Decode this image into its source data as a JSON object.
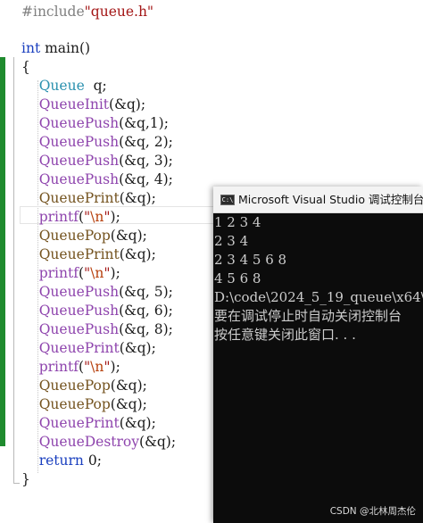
{
  "editor": {
    "lines": [
      [
        {
          "t": "#include",
          "c": "pre"
        },
        {
          "t": "\"queue.h\"",
          "c": "str"
        }
      ],
      [],
      [
        {
          "t": "int",
          "c": "kw"
        },
        {
          "t": " main()",
          "c": ""
        }
      ],
      [
        {
          "t": "{",
          "c": ""
        }
      ],
      [
        {
          "t": "    ",
          "c": ""
        },
        {
          "t": "Queue",
          "c": "type"
        },
        {
          "t": "  q;",
          "c": ""
        }
      ],
      [
        {
          "t": "    ",
          "c": ""
        },
        {
          "t": "QueueInit",
          "c": "macro"
        },
        {
          "t": "(&q);",
          "c": ""
        }
      ],
      [
        {
          "t": "    ",
          "c": ""
        },
        {
          "t": "QueuePush",
          "c": "macro"
        },
        {
          "t": "(&q,1);",
          "c": ""
        }
      ],
      [
        {
          "t": "    ",
          "c": ""
        },
        {
          "t": "QueuePush",
          "c": "macro"
        },
        {
          "t": "(&q, 2);",
          "c": ""
        }
      ],
      [
        {
          "t": "    ",
          "c": ""
        },
        {
          "t": "QueuePush",
          "c": "macro"
        },
        {
          "t": "(&q, 3);",
          "c": ""
        }
      ],
      [
        {
          "t": "    ",
          "c": ""
        },
        {
          "t": "QueuePush",
          "c": "macro"
        },
        {
          "t": "(&q, 4);",
          "c": ""
        }
      ],
      [
        {
          "t": "    ",
          "c": ""
        },
        {
          "t": "QueuePrint",
          "c": "fn"
        },
        {
          "t": "(&q);",
          "c": ""
        }
      ],
      [
        {
          "t": "    ",
          "c": ""
        },
        {
          "t": "printf",
          "c": "macro"
        },
        {
          "t": "(",
          "c": ""
        },
        {
          "t": "\"",
          "c": "str"
        },
        {
          "t": "\\n",
          "c": "esc"
        },
        {
          "t": "\"",
          "c": "str"
        },
        {
          "t": ");",
          "c": ""
        }
      ],
      [
        {
          "t": "    ",
          "c": ""
        },
        {
          "t": "QueuePop",
          "c": "fn"
        },
        {
          "t": "(&q);",
          "c": ""
        }
      ],
      [
        {
          "t": "    ",
          "c": ""
        },
        {
          "t": "QueuePrint",
          "c": "fn"
        },
        {
          "t": "(&q);",
          "c": ""
        }
      ],
      [
        {
          "t": "    ",
          "c": ""
        },
        {
          "t": "printf",
          "c": "macro"
        },
        {
          "t": "(",
          "c": ""
        },
        {
          "t": "\"",
          "c": "str"
        },
        {
          "t": "\\n",
          "c": "esc"
        },
        {
          "t": "\"",
          "c": "str"
        },
        {
          "t": ");",
          "c": ""
        }
      ],
      [
        {
          "t": "    ",
          "c": ""
        },
        {
          "t": "QueuePush",
          "c": "macro"
        },
        {
          "t": "(&q, 5);",
          "c": ""
        }
      ],
      [
        {
          "t": "    ",
          "c": ""
        },
        {
          "t": "QueuePush",
          "c": "macro"
        },
        {
          "t": "(&q, 6);",
          "c": ""
        }
      ],
      [
        {
          "t": "    ",
          "c": ""
        },
        {
          "t": "QueuePush",
          "c": "macro"
        },
        {
          "t": "(&q, 8);",
          "c": ""
        }
      ],
      [
        {
          "t": "    ",
          "c": ""
        },
        {
          "t": "QueuePrint",
          "c": "macro"
        },
        {
          "t": "(&q);",
          "c": ""
        }
      ],
      [
        {
          "t": "    ",
          "c": ""
        },
        {
          "t": "printf",
          "c": "macro"
        },
        {
          "t": "(",
          "c": ""
        },
        {
          "t": "\"",
          "c": "str"
        },
        {
          "t": "\\n",
          "c": "esc"
        },
        {
          "t": "\"",
          "c": "str"
        },
        {
          "t": ");",
          "c": ""
        }
      ],
      [
        {
          "t": "    ",
          "c": ""
        },
        {
          "t": "QueuePop",
          "c": "fn"
        },
        {
          "t": "(&q);",
          "c": ""
        }
      ],
      [
        {
          "t": "    ",
          "c": ""
        },
        {
          "t": "QueuePop",
          "c": "fn"
        },
        {
          "t": "(&q);",
          "c": ""
        }
      ],
      [
        {
          "t": "    ",
          "c": ""
        },
        {
          "t": "QueuePrint",
          "c": "macro"
        },
        {
          "t": "(&q);",
          "c": ""
        }
      ],
      [
        {
          "t": "    ",
          "c": ""
        },
        {
          "t": "QueueDestroy",
          "c": "macro"
        },
        {
          "t": "(&q);",
          "c": ""
        }
      ],
      [
        {
          "t": "    ",
          "c": ""
        },
        {
          "t": "return",
          "c": "kw"
        },
        {
          "t": " 0;",
          "c": ""
        }
      ],
      [
        {
          "t": "}",
          "c": ""
        }
      ]
    ]
  },
  "console": {
    "icon_name": "console-app-icon",
    "icon_text": "C:\\",
    "title": "Microsoft Visual Studio 调试控制台",
    "output": [
      "1 2 3 4",
      "2 3 4",
      "2 3 4 5 6 8",
      "4 5 6 8",
      "D:\\code\\2024_5_19_queue\\x64\\",
      "要在调试停止时自动关闭控制台",
      "按任意键关闭此窗口. . ."
    ]
  },
  "watermark": "CSDN @北林周杰伦",
  "colors": {
    "change_bar": "#1f8b2e",
    "console_bg": "#0c0c0c",
    "console_text": "#cccccc",
    "keyword": "#1a3fbf",
    "string": "#a31515",
    "preprocessor": "#808080",
    "macro": "#8e44ad",
    "type": "#2b91af",
    "function": "#74531f"
  }
}
